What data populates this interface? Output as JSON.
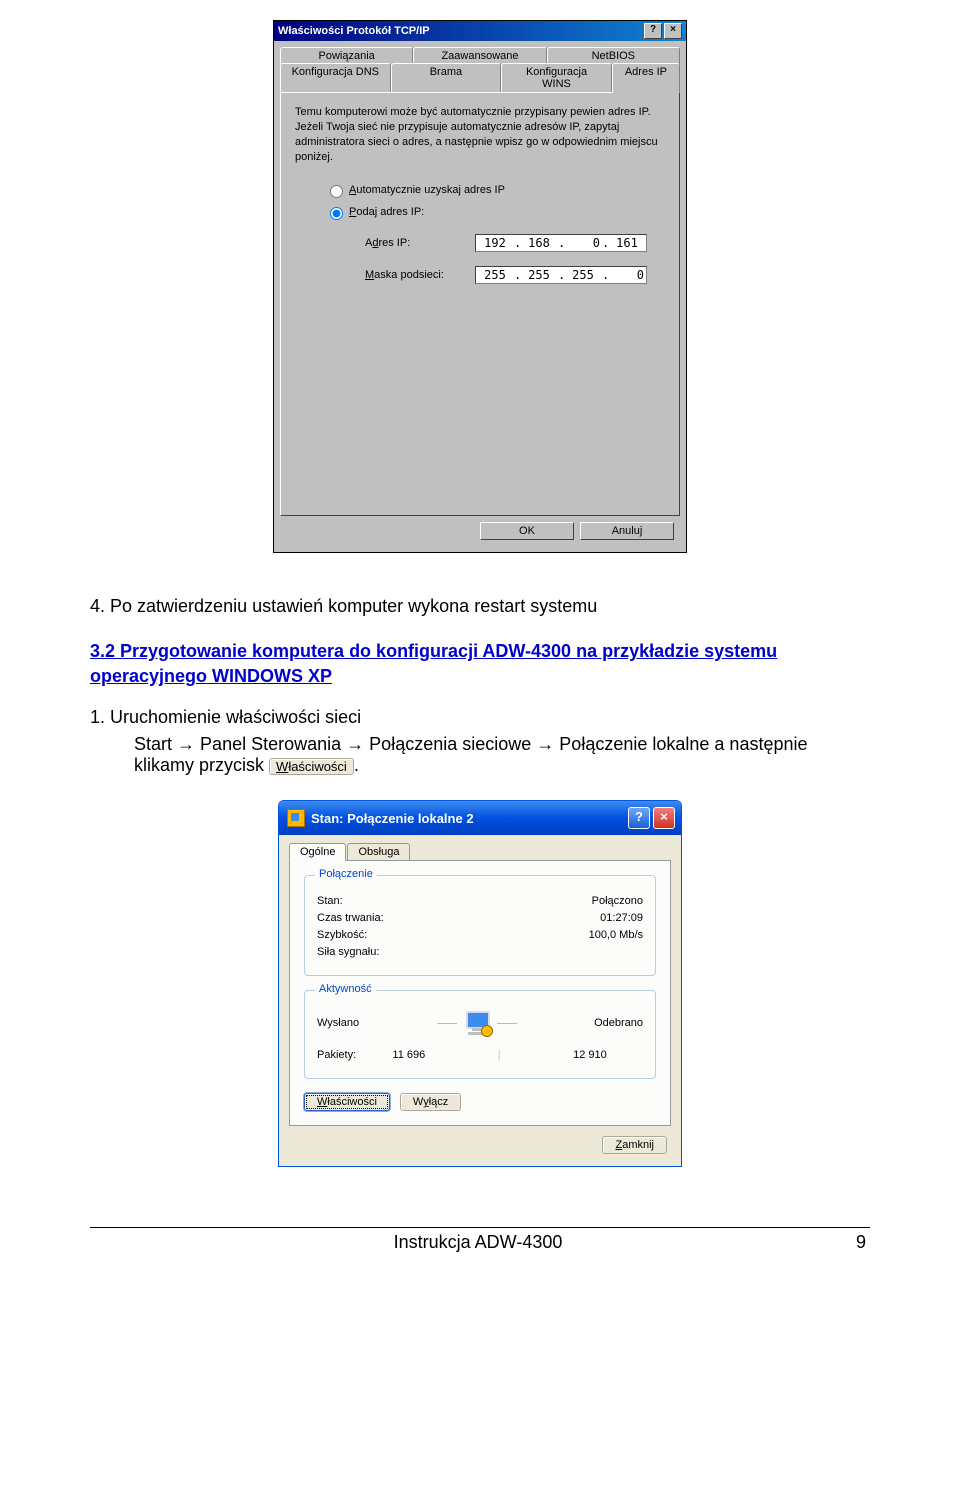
{
  "win98": {
    "title": "Właściwości Protokół TCP/IP",
    "help_btn": "?",
    "close_btn": "×",
    "tabs_back": [
      "Powiązania",
      "Zaawansowane",
      "NetBIOS"
    ],
    "tabs_front": [
      "Konfiguracja DNS",
      "Brama",
      "Konfiguracja WINS",
      "Adres IP"
    ],
    "active_tab": "Adres IP",
    "description": "Temu komputerowi może być automatycznie przypisany pewien adres IP. Jeżeli Twoja sieć nie przypisuje automatycznie adresów IP, zapytaj administratora sieci o adres, a następnie wpisz go w odpowiednim miejscu poniżej.",
    "radio_auto": "Automatycznie uzyskaj adres IP",
    "radio_manual": "Podaj adres IP:",
    "ip_label": "Adres IP:",
    "mask_label": "Maska podsieci:",
    "ip": [
      "192",
      "168",
      "0",
      "161"
    ],
    "mask": [
      "255",
      "255",
      "255",
      "0"
    ],
    "ok": "OK",
    "cancel": "Anuluj"
  },
  "text": {
    "line1": "4.    Po zatwierdzeniu ustawień komputer wykona restart systemu",
    "section_heading": "3.2 Przygotowanie komputera do konfiguracji ADW-4300 na przykładzie systemu operacyjnego WINDOWS XP",
    "item1_title": "1.   Uruchomienie właściwości sieci",
    "start": "Start",
    "panel": "Panel Sterowania",
    "polaczenia": "Połączenia sieciowe",
    "polaczenie_lokalne": "Połączenie",
    "lokalne_then": "lokalne a następnie klikamy przycisk",
    "inline_btn_u": "W",
    "inline_btn_rest": "łaściwości",
    "period": "."
  },
  "xp": {
    "title": "Stan: Połączenie lokalne 2",
    "tabs": [
      "Ogólne",
      "Obsługa"
    ],
    "group_conn": "Połączenie",
    "conn_stan_lbl": "Stan:",
    "conn_stan_val": "Połączono",
    "conn_czas_lbl": "Czas trwania:",
    "conn_czas_val": "01:27:09",
    "conn_szyb_lbl": "Szybkość:",
    "conn_szyb_val": "100,0 Mb/s",
    "conn_sila_lbl": "Siła sygnału:",
    "group_act": "Aktywność",
    "wyslano": "Wysłano",
    "odebrano": "Odebrano",
    "pakiety_lbl": "Pakiety:",
    "pakiety_tx": "11 696",
    "pakiety_rx": "12 910",
    "btn_wlasciwosci_u": "W",
    "btn_wlasciwosci_rest": "łaściwości",
    "btn_wylacz": "Wyłącz",
    "btn_wylacz_u": "y",
    "btn_wylacz_pre": "W",
    "btn_wylacz_post": "łącz",
    "btn_zamknij_u": "Z",
    "btn_zamknij_rest": "amknij"
  },
  "footer": {
    "center": "Instrukcja ADW-4300",
    "page": "9"
  }
}
